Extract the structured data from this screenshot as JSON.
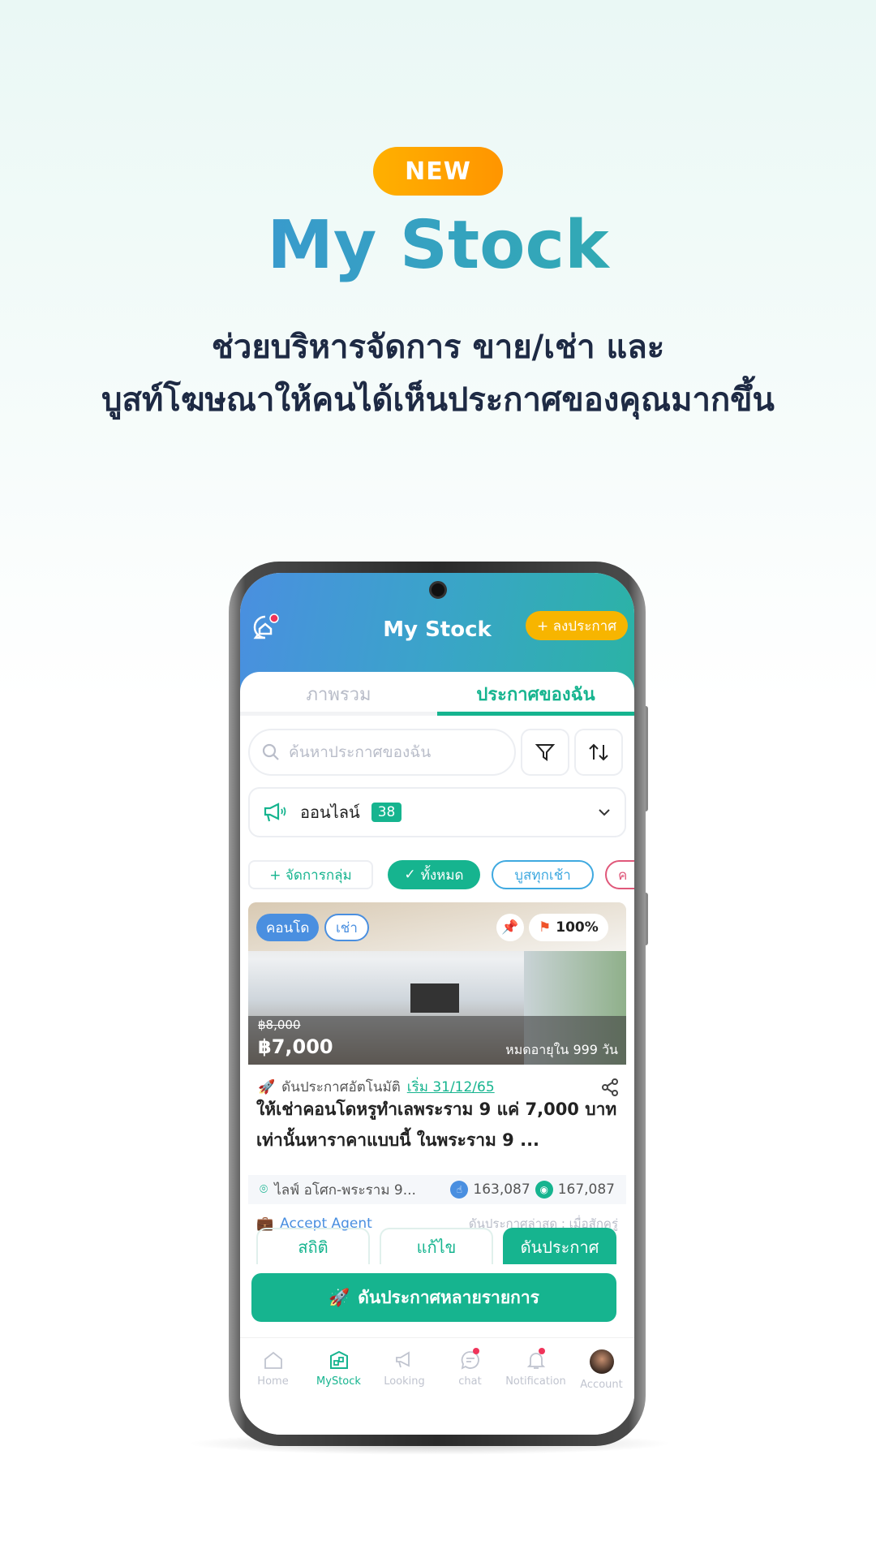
{
  "promo": {
    "badge": "NEW",
    "title": "My Stock",
    "subtitle_line1": "ช่วยบริหารจัดการ ขาย/เช่า และ",
    "subtitle_line2": "บูสท์โฆษณาให้คนได้เห็นประกาศของคุณมากขึ้น"
  },
  "app": {
    "header": {
      "title": "My Stock",
      "post_button": "+ ลงประกาศ"
    },
    "tabs": [
      {
        "label": "ภาพรวม",
        "active": false
      },
      {
        "label": "ประกาศของฉัน",
        "active": true
      }
    ],
    "search": {
      "placeholder": "ค้นหาประกาศของฉัน"
    },
    "status_filter": {
      "label": "ออนไลน์",
      "count": "38"
    },
    "chips": {
      "manage": "+ จัดการกลุ่ม",
      "all": "ทั้งหมด",
      "boost_morning": "บูสทุกเช้า",
      "next": "ค"
    },
    "listing": {
      "type": "คอนโด",
      "deal": "เช่า",
      "rank": "100%",
      "old_price": "฿8,000",
      "price": "฿7,000",
      "expiry": "หมดอายุใน 999 วัน",
      "auto_boost": "ดันประกาศอัตโนมัติ",
      "auto_boost_start": "เริ่ม 31/12/65",
      "title": "ให้เช่าคอนโดหรูทำเลพระราม 9 แค่ 7,000 บาท เท่านั้นหาราคาแบบนี้ ในพระราม 9 ...",
      "location": "ไลฟ์ อโศก-พระราม 9...",
      "clicks": "163,087",
      "views": "167,087",
      "agent": "Accept Agent",
      "last_boost": "ดันประกาศล่าสุด : เมื่อสักครู่",
      "actions": {
        "stats": "สถิติ",
        "edit": "แก้ไข",
        "boost": "ดันประกาศ"
      }
    },
    "bulk_boost": "ดันประกาศหลายรายการ",
    "nav": [
      {
        "label": "Home"
      },
      {
        "label": "MyStock",
        "active": true
      },
      {
        "label": "Looking"
      },
      {
        "label": "chat"
      },
      {
        "label": "Notification"
      },
      {
        "label": "Account"
      }
    ]
  },
  "colors": {
    "accent": "#16b48f",
    "orange": "#f7b500",
    "blue": "#4a8fe0"
  }
}
